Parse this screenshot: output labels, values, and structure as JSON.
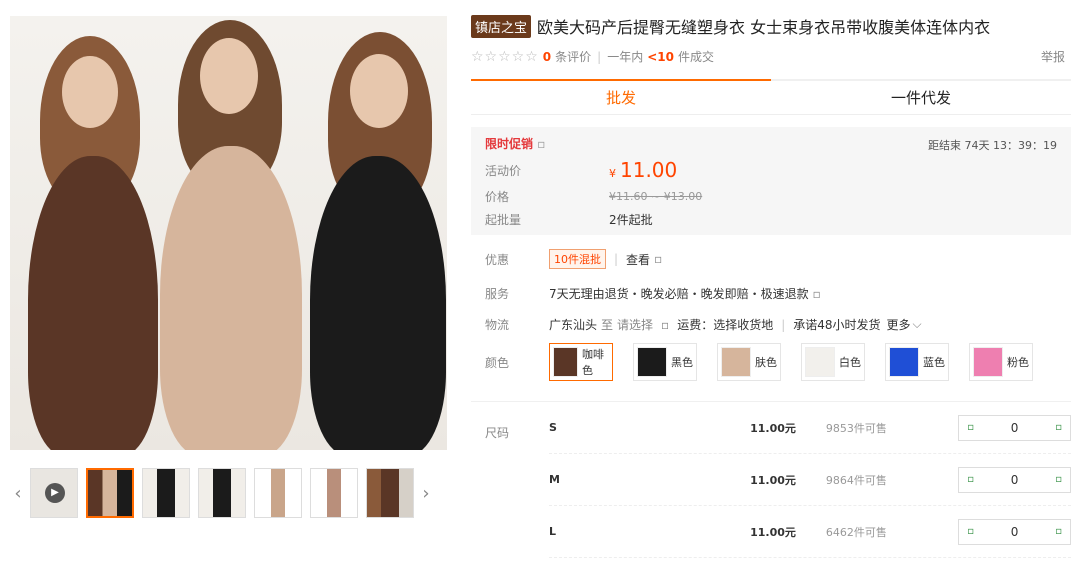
{
  "product": {
    "shop_badge": "镇店之宝",
    "title": "欧美大码产后提臀无缝塑身衣 女士束身衣吊带收腹美体连体内衣",
    "review_count": "0",
    "review_label": "条评价",
    "sales_prefix": "一年内",
    "sales_count": "<10",
    "sales_suffix": "件成交",
    "report": "举报",
    "stars": "☆☆☆☆☆"
  },
  "tabs": [
    "批发",
    "一件代发"
  ],
  "promo": {
    "label": "限时促销",
    "countdown_label": "距结束",
    "countdown": "74天 13：39：19",
    "activity_price_label": "活动价",
    "currency": "¥",
    "activity_price": "11.00",
    "orig_price_label": "价格",
    "orig_price": "¥11.60 ~ ¥13.00",
    "min_label": "起批量",
    "min_value": "2件起批"
  },
  "offers": {
    "label": "优惠",
    "tag": "10件混批",
    "view": "查看"
  },
  "service": {
    "label": "服务",
    "text": "7天无理由退货・晚发必赔・晚发即赔・极速退款"
  },
  "logistics": {
    "label": "物流",
    "from": "广东汕头",
    "to_label": "至",
    "to": "请选择",
    "fee": "运费：选择收货地",
    "promise": "承诺48小时发货",
    "more": "更多"
  },
  "colors": {
    "label": "颜色",
    "items": [
      {
        "name": "咖啡色",
        "hex": "#5a3626"
      },
      {
        "name": "黑色",
        "hex": "#1b1b1b"
      },
      {
        "name": "肤色",
        "hex": "#d6b59c"
      },
      {
        "name": "白色",
        "hex": "#f2f0ec"
      },
      {
        "name": "蓝色",
        "hex": "#1f4fd6"
      },
      {
        "name": "粉色",
        "hex": "#ee7fb0"
      }
    ]
  },
  "sizes": {
    "label": "尺码",
    "rows": [
      {
        "size": "S",
        "price": "11.00元",
        "stock": "9853件可售",
        "qty": "0"
      },
      {
        "size": "M",
        "price": "11.00元",
        "stock": "9864件可售",
        "qty": "0"
      },
      {
        "size": "L",
        "price": "11.00元",
        "stock": "6462件可售",
        "qty": "0"
      }
    ]
  },
  "gallery": {
    "model_colors": [
      "#5a3626",
      "#d6b59c",
      "#1b1b1b"
    ],
    "thumb_count": 7
  }
}
